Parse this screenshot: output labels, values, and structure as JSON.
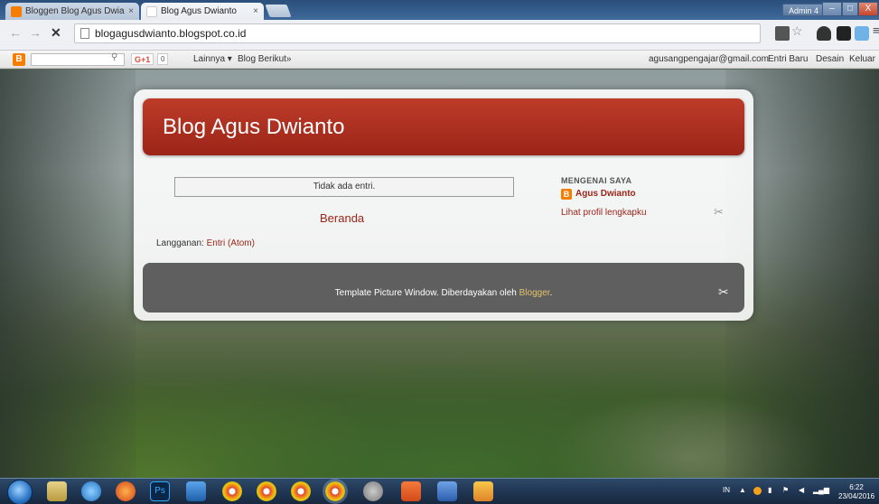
{
  "browser": {
    "tabs": [
      {
        "title": "Bloggen Blog Agus Dwian",
        "close": "×"
      },
      {
        "title": "Blog Agus Dwianto",
        "close": "×"
      }
    ],
    "user_badge": "Admin 4",
    "window_buttons": {
      "minimize": "–",
      "maximize": "□",
      "close": "X"
    },
    "url": "blogagusdwianto.blogspot.co.id"
  },
  "blogger_navbar": {
    "logo": "B",
    "gplus": "G+1",
    "gplus_count": "0",
    "more": "Lainnya ▾",
    "next_blog": "Blog Berikut»",
    "email": "agusangpengajar@gmail.com",
    "new_post": "Entri Baru",
    "design": "Desain",
    "sign_out": "Keluar"
  },
  "blog": {
    "title": "Blog Agus Dwianto",
    "no_posts": "Tidak ada entri.",
    "home": "Beranda",
    "subscribe_label": "Langganan: ",
    "subscribe_link": "Entri (Atom)",
    "sidebar": {
      "title": "MENGENAI SAYA",
      "profile_icon": "B",
      "name": "Agus Dwianto",
      "profile_link": "Lihat profil lengkapku"
    },
    "footer": {
      "text": "Template Picture Window. Diberdayakan oleh ",
      "link": "Blogger",
      "period": "."
    }
  },
  "taskbar": {
    "language": "IN",
    "time": "6:22",
    "date": "23/04/2016"
  },
  "colors": {
    "header_red": "#9b2518",
    "link_red": "#9b2518",
    "blogger_orange": "#f57d00",
    "footer_gray": "#5f5f5f"
  }
}
